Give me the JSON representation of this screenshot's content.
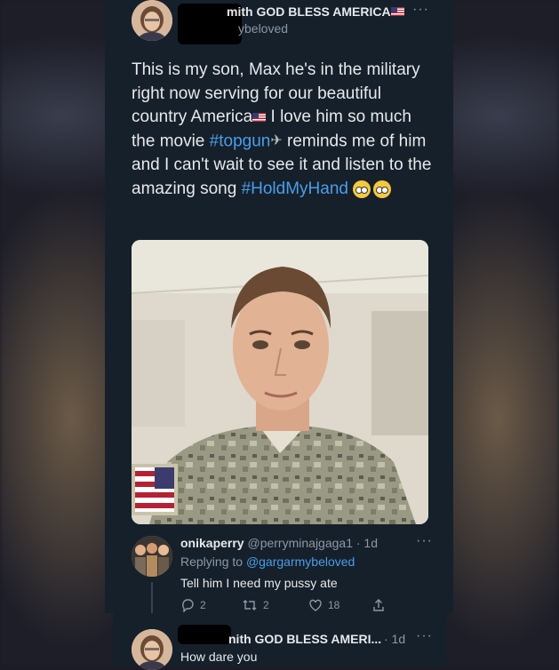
{
  "main_tweet": {
    "display_name": "mith GOD BLESS AMERICA",
    "handle": "ybeloved",
    "text_1": "This is my son, Max he's in the military right now serving for our beautiful country America",
    "text_2": " I love him so much the movie ",
    "hashtag_1": "#topgun",
    "text_3": " reminds me of him and I can't wait to see it and listen to the amazing song ",
    "hashtag_2": "#HoldMyHand",
    "more_label": "···"
  },
  "reply": {
    "display_name": "onikaperry",
    "handle": "@perryminajgaga1 · 1d",
    "replying_prefix": "Replying to ",
    "replying_handle": "@gargarmybeloved",
    "text": "Tell him I need my pussy ate",
    "reply_count": "2",
    "retweet_count": "2",
    "like_count": "18",
    "more_label": "···"
  },
  "second_reply": {
    "display_name": "nith GOD BLESS AMERI...",
    "meta": "· 1d",
    "text": "How dare you",
    "more_label": "···"
  },
  "colors": {
    "background": "#15202b",
    "link": "#4a9ee8",
    "muted": "#8b98a5"
  }
}
